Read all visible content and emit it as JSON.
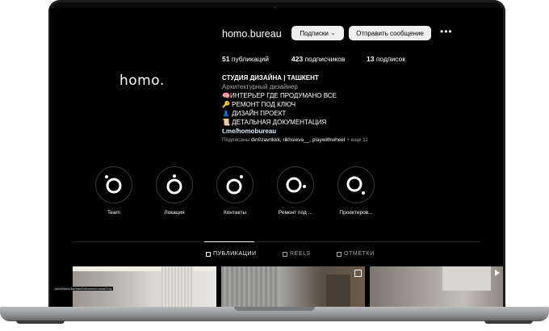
{
  "profile": {
    "logo_text": "homo.",
    "username": "homo.bureau",
    "follow_button_label": "Подписки",
    "message_button_label": "Отправить сообщение",
    "more_icon": "more-horizontal-icon",
    "stats": {
      "posts_count": "51",
      "posts_label": "публикаций",
      "followers_count": "423",
      "followers_label": "подписчиков",
      "following_count": "13",
      "following_label": "подписок"
    },
    "bio": {
      "name": "СТУДИЯ ДИЗАЙНА | ТАШКЕНТ",
      "category": "Архитектурный дизайнер",
      "lines": [
        "🧠ИНТЕРЬЕР ГДЕ ПРОДУМАНО ВСЕ",
        "🔑 РЕМОНТ ПОД КЛЮЧ",
        "👗 ДИЗАЙН ПРОЕКТ",
        "📜 ДЕТАЛЬНАЯ ДОКУМЕНТАЦИЯ"
      ],
      "link": "t.me/homobureau"
    },
    "followed_by": {
      "prefix": "Подписаны",
      "names": "din0zavrikkk, rikhsieva__, playwithwheel",
      "suffix": "+ еще 11"
    }
  },
  "highlights": [
    {
      "label": "Team"
    },
    {
      "label": "Локация"
    },
    {
      "label": "Контакты"
    },
    {
      "label": "Ремонт под ..."
    },
    {
      "label": "Проектиров..."
    }
  ],
  "tabs": [
    {
      "label": "ПУБЛИКАЦИИ",
      "icon": "grid-icon",
      "active": true
    },
    {
      "label": "REELS",
      "icon": "reels-icon",
      "active": false
    },
    {
      "label": "ОТМЕТКИ",
      "icon": "tagged-icon",
      "active": false
    }
  ],
  "status_url": "com/homo.bureau/followers/mutualOnly",
  "colors": {
    "background": "#000000",
    "button_bg": "#efefef",
    "link": "#e0f1ff",
    "muted_text": "#a8a8a8"
  }
}
